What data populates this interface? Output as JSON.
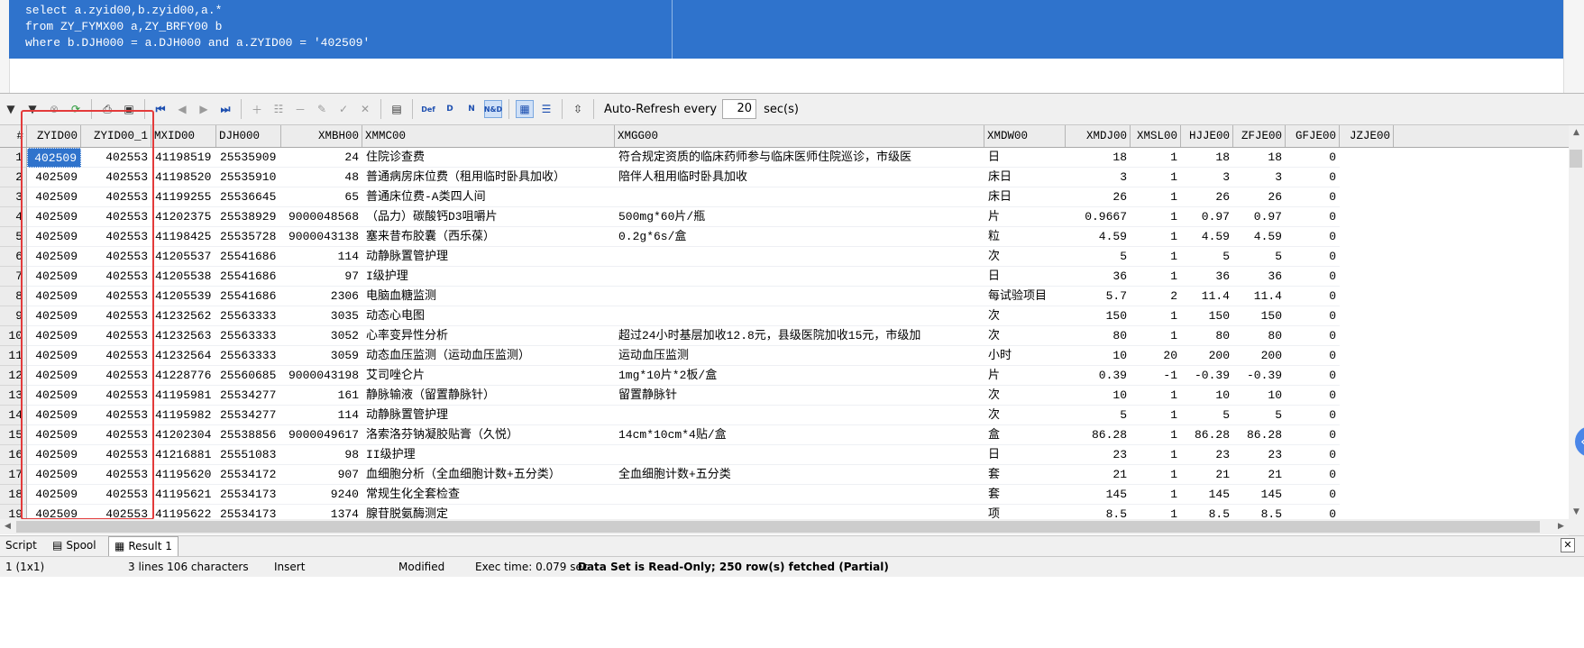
{
  "editor": {
    "lines": [
      "select a.zyid00,b.zyid00,a.*",
      "from ZY_FYMX00 a,ZY_BRFY00 b",
      "where b.DJH000 = a.DJH000 and a.ZYID00 = '402509'"
    ]
  },
  "toolbar": {
    "auto_refresh_label": "Auto-Refresh every",
    "auto_refresh_value": "20",
    "auto_refresh_unit": "sec(s)",
    "def_label": "Def",
    "d_label": "D",
    "n_label": "N",
    "nd_label": "N&D"
  },
  "grid": {
    "rownum_header": "#",
    "columns": [
      "ZYID00",
      "ZYID00_1",
      "MXID00",
      "DJH000",
      "XMBH00",
      "XMMC00",
      "XMGG00",
      "XMDW00",
      "XMDJ00",
      "XMSL00",
      "HJJE00",
      "ZFJE00",
      "GFJE00",
      "JZJE00"
    ],
    "rows": [
      [
        "1",
        "402509",
        "402553",
        "41198519",
        "25535909",
        "24",
        "住院诊查费",
        "符合规定资质的临床药师参与临床医师住院巡诊，市级医",
        "日",
        "18",
        "1",
        "18",
        "18",
        "0"
      ],
      [
        "2",
        "402509",
        "402553",
        "41198520",
        "25535910",
        "48",
        "普通病房床位费（租用临时卧具加收）",
        "陪伴人租用临时卧具加收",
        "床日",
        "3",
        "1",
        "3",
        "3",
        "0"
      ],
      [
        "3",
        "402509",
        "402553",
        "41199255",
        "25536645",
        "65",
        "普通床位费-A类四人间",
        "",
        "床日",
        "26",
        "1",
        "26",
        "26",
        "0"
      ],
      [
        "4",
        "402509",
        "402553",
        "41202375",
        "25538929",
        "9000048568",
        "（品力）碳酸钙D3咀嚼片",
        "500mg*60片/瓶",
        "片",
        "0.9667",
        "1",
        "0.97",
        "0.97",
        "0"
      ],
      [
        "5",
        "402509",
        "402553",
        "41198425",
        "25535728",
        "9000043138",
        "塞来昔布胶囊（西乐葆）",
        "0.2g*6s/盒",
        "粒",
        "4.59",
        "1",
        "4.59",
        "4.59",
        "0"
      ],
      [
        "6",
        "402509",
        "402553",
        "41205537",
        "25541686",
        "114",
        "动静脉置管护理",
        "",
        "次",
        "5",
        "1",
        "5",
        "5",
        "0"
      ],
      [
        "7",
        "402509",
        "402553",
        "41205538",
        "25541686",
        "97",
        "I级护理",
        "",
        "日",
        "36",
        "1",
        "36",
        "36",
        "0"
      ],
      [
        "8",
        "402509",
        "402553",
        "41205539",
        "25541686",
        "2306",
        "电脑血糖监测",
        "",
        "每试验项目",
        "5.7",
        "2",
        "11.4",
        "11.4",
        "0"
      ],
      [
        "9",
        "402509",
        "402553",
        "41232562",
        "25563333",
        "3035",
        "动态心电图",
        "",
        "次",
        "150",
        "1",
        "150",
        "150",
        "0"
      ],
      [
        "10",
        "402509",
        "402553",
        "41232563",
        "25563333",
        "3052",
        "心率变异性分析",
        "超过24小时基层加收12.8元，县级医院加收15元，市级加",
        "次",
        "80",
        "1",
        "80",
        "80",
        "0"
      ],
      [
        "11",
        "402509",
        "402553",
        "41232564",
        "25563333",
        "3059",
        "动态血压监测（运动血压监测）",
        "运动血压监测",
        "小时",
        "10",
        "20",
        "200",
        "200",
        "0"
      ],
      [
        "12",
        "402509",
        "402553",
        "41228776",
        "25560685",
        "9000043198",
        "艾司唑仑片",
        "1mg*10片*2板/盒",
        "片",
        "0.39",
        "-1",
        "-0.39",
        "-0.39",
        "0"
      ],
      [
        "13",
        "402509",
        "402553",
        "41195981",
        "25534277",
        "161",
        "静脉输液（留置静脉针）",
        "留置静脉针",
        "次",
        "10",
        "1",
        "10",
        "10",
        "0"
      ],
      [
        "14",
        "402509",
        "402553",
        "41195982",
        "25534277",
        "114",
        "动静脉置管护理",
        "",
        "次",
        "5",
        "1",
        "5",
        "5",
        "0"
      ],
      [
        "15",
        "402509",
        "402553",
        "41202304",
        "25538856",
        "9000049617",
        "洛索洛芬钠凝胶贴膏（久悦）",
        "14cm*10cm*4贴/盒",
        "盒",
        "86.28",
        "1",
        "86.28",
        "86.28",
        "0"
      ],
      [
        "16",
        "402509",
        "402553",
        "41216881",
        "25551083",
        "98",
        "II级护理",
        "",
        "日",
        "23",
        "1",
        "23",
        "23",
        "0"
      ],
      [
        "17",
        "402509",
        "402553",
        "41195620",
        "25534172",
        "907",
        "血细胞分析（全血细胞计数+五分类）",
        "全血细胞计数+五分类",
        "套",
        "21",
        "1",
        "21",
        "21",
        "0"
      ],
      [
        "18",
        "402509",
        "402553",
        "41195621",
        "25534173",
        "9240",
        "常规生化全套检查",
        "",
        "套",
        "145",
        "1",
        "145",
        "145",
        "0"
      ],
      [
        "19",
        "402509",
        "402553",
        "41195622",
        "25534173",
        "1374",
        "腺苷脱氨酶测定",
        "",
        "项",
        "8.5",
        "1",
        "8.5",
        "8.5",
        "0"
      ]
    ]
  },
  "tabs": {
    "script": "Script",
    "spool": "Spool",
    "result": "Result 1"
  },
  "status": {
    "position": "1 (1x1)",
    "lines": "3 lines 106 characters",
    "mode": "Insert",
    "state": "Modified",
    "exec_time": "Exec time: 0.079 sec",
    "message": "Data Set is Read-Only; 250 row(s) fetched (Partial)"
  }
}
